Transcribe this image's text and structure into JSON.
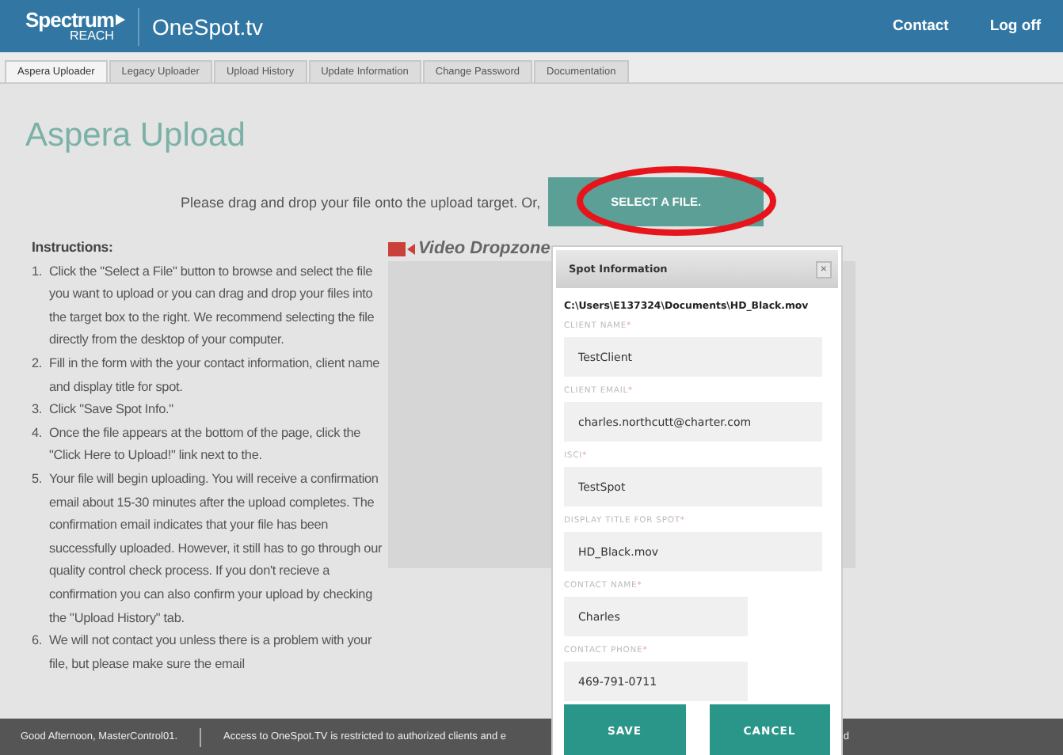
{
  "header": {
    "logo": {
      "brand": "Spectrum",
      "sub": "REACH"
    },
    "site": "OneSpot.tv",
    "links": [
      "Contact",
      "Log off"
    ]
  },
  "tabs": [
    {
      "label": "Aspera Uploader",
      "selected": true
    },
    {
      "label": "Legacy Uploader",
      "selected": false
    },
    {
      "label": "Upload History",
      "selected": false
    },
    {
      "label": "Update Information",
      "selected": false
    },
    {
      "label": "Change Password",
      "selected": false
    },
    {
      "label": "Documentation",
      "selected": false
    }
  ],
  "page_title": "Aspera Upload",
  "drag_prompt": "Please drag and drop your file onto the upload target. Or,",
  "select_button": "SELECT A FILE.",
  "annotation": {
    "kind": "ellipse"
  },
  "instructions": {
    "heading": "Instructions:",
    "steps": [
      {
        "number": "1.",
        "text": "Click the \"Select a File\" button to browse and select the file you want to upload or you can drag and drop your files into the target box to the right. We recommend selecting the file directly from the desktop of your computer."
      },
      {
        "number": "2.",
        "text": "Fill in the form with the your contact information, client name and display title for spot."
      },
      {
        "number": "3.",
        "text": "Click \"Save Spot Info.\""
      },
      {
        "number": "4.",
        "text": "Once the file appears at the bottom of the page, click the \"Click Here to Upload!\" link next to the."
      },
      {
        "number": "5.",
        "text": "Your file will begin uploading. You will receive a confirmation email about 15-30 minutes after the upload completes. The confirmation email indicates that your file has been successfully uploaded. However, it still has to go through our quality control check process.  If you don't recieve a confirmation you can also confirm your upload by checking the \"Upload History\" tab."
      },
      {
        "number": "6.",
        "text": "We will not contact you unless there is a problem with your file, but please make sure the email"
      }
    ]
  },
  "dropzone": {
    "label": "Video Dropzone"
  },
  "modal": {
    "title": "Spot Information",
    "close": "×",
    "file_path": "C:\\Users\\E137324\\Documents\\HD_Black.mov",
    "fields": [
      {
        "label": "CLIENT NAME",
        "required_mark": "*",
        "value": "TestClient",
        "kind": "wide"
      },
      {
        "label": "CLIENT EMAIL",
        "required_mark": "*",
        "value": "charles.northcutt@charter.com",
        "kind": "wide"
      },
      {
        "label": "ISCI",
        "required_mark": "*",
        "value": "TestSpot",
        "kind": "wide"
      },
      {
        "label": "DISPLAY TITLE FOR SPOT",
        "required_mark": "*",
        "value": "HD_Black.mov",
        "kind": "wide"
      },
      {
        "label": "CONTACT NAME",
        "required_mark": "*",
        "value": "Charles",
        "kind": "short"
      },
      {
        "label": "CONTACT PHONE",
        "required_mark": "*",
        "value": "469-791-0711",
        "kind": "short"
      }
    ],
    "buttons": [
      "SAVE",
      "CANCEL"
    ]
  },
  "footer": {
    "greeting": "Good Afternoon, MasterControl01.",
    "notice": "Access to OneSpot.TV is restricted to authorized clients and e",
    "notice_tail": "d"
  }
}
